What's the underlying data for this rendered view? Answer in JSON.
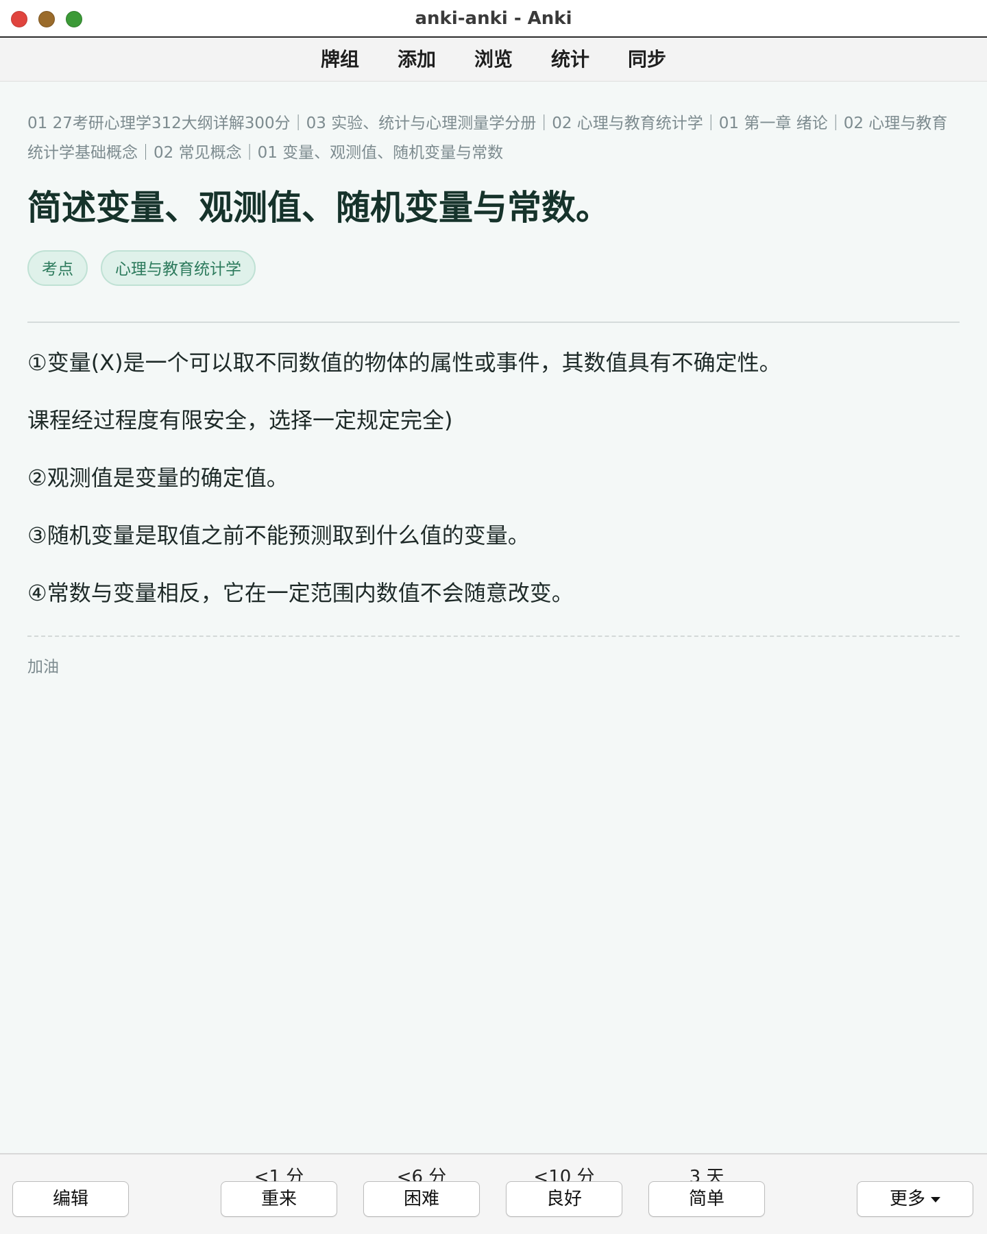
{
  "window": {
    "title": "anki-anki - Anki"
  },
  "toolbar": {
    "items": [
      {
        "label": "牌组"
      },
      {
        "label": "添加"
      },
      {
        "label": "浏览"
      },
      {
        "label": "统计"
      },
      {
        "label": "同步"
      }
    ]
  },
  "card": {
    "deck_path": "01 27考研心理学312大纲详解300分｜03 实验、统计与心理测量学分册｜02 心理与教育统计学｜01 第一章 绪论｜02 心理与教育统计学基础概念｜02 常见概念｜01 变量、观测值、随机变量与常数",
    "question": "简述变量、观测值、随机变量与常数。",
    "tags": [
      {
        "label": "考点"
      },
      {
        "label": "心理与教育统计学"
      }
    ],
    "answer_lines": [
      "①变量(X)是一个可以取不同数值的物体的属性或事件，其数值具有不确定性。",
      "课程经过程度有限安全，选择一定规定完全)",
      "②观测值是变量的确定值。",
      "③随机变量是取值之前不能预测取到什么值的变量。",
      "④常数与变量相反，它在一定范围内数值不会随意改变。"
    ],
    "extra": "加油"
  },
  "answer_bar": {
    "edit_label": "编辑",
    "more_label": "更多",
    "buttons": [
      {
        "label": "重来",
        "interval": "<1 分"
      },
      {
        "label": "困难",
        "interval": "<6 分"
      },
      {
        "label": "良好",
        "interval": "<10 分"
      },
      {
        "label": "简单",
        "interval": "3 天"
      }
    ]
  }
}
